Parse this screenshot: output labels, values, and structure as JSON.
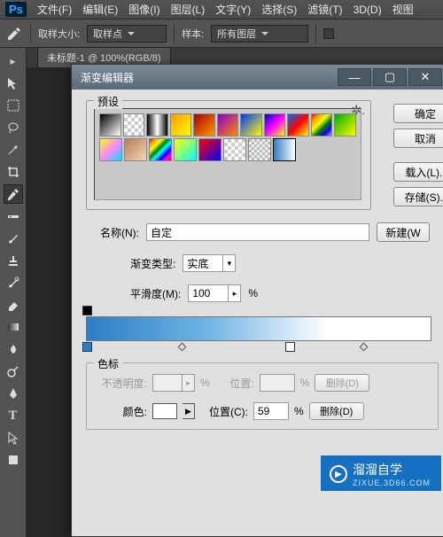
{
  "menubar": {
    "items": [
      "文件(F)",
      "编辑(E)",
      "图像(I)",
      "图层(L)",
      "文字(Y)",
      "选择(S)",
      "滤镜(T)",
      "3D(D)",
      "视图"
    ]
  },
  "optbar": {
    "sample_size_label": "取样大小:",
    "sample_size_value": "取样点",
    "sample_label": "样本:",
    "sample_value": "所有图层"
  },
  "doctab": {
    "label": "未标题-1 @ 100%(RGB/8)"
  },
  "dlg": {
    "title": "渐变编辑器",
    "presets_label": "预设",
    "ok": "确定",
    "cancel": "取消",
    "load": "载入(L)..",
    "save": "存储(S)..",
    "name_label": "名称(N):",
    "name_value": "自定",
    "new_btn": "新建(W",
    "type_label": "渐变类型:",
    "type_value": "实底",
    "smooth_label": "平滑度(M):",
    "smooth_value": "100",
    "pct": "%",
    "stops_label": "色标",
    "opacity_label": "不透明度:",
    "pos_label": "位置:",
    "posc_label": "位置(C):",
    "posc_value": "59",
    "color_label": "颜色:",
    "delete": "删除(D)"
  },
  "wm": {
    "text": "溜溜自学",
    "sub": "ZIXUE.3D66.COM"
  }
}
